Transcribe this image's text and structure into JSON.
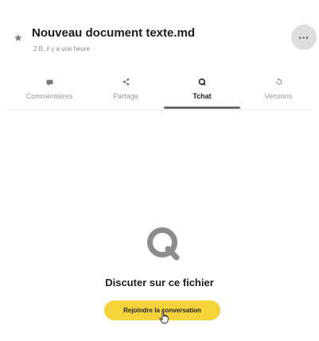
{
  "header": {
    "title": "Nouveau document texte.md",
    "subtitle": "2 B, il y a une heure",
    "more_label": "···"
  },
  "tabs": [
    {
      "label": "Commentaires",
      "icon": "comment-icon"
    },
    {
      "label": "Partage",
      "icon": "share-icon"
    },
    {
      "label": "Tchat",
      "icon": "chat-icon",
      "active": true
    },
    {
      "label": "Versions",
      "icon": "history-icon"
    }
  ],
  "empty_state": {
    "icon": "chat-icon",
    "title": "Discuter sur ce fichier",
    "button_label": "Rejoindre la conversation"
  },
  "colors": {
    "accent": "#f5d43b",
    "more_button": "#dedede",
    "chat_icon": "#8c8c8c"
  }
}
